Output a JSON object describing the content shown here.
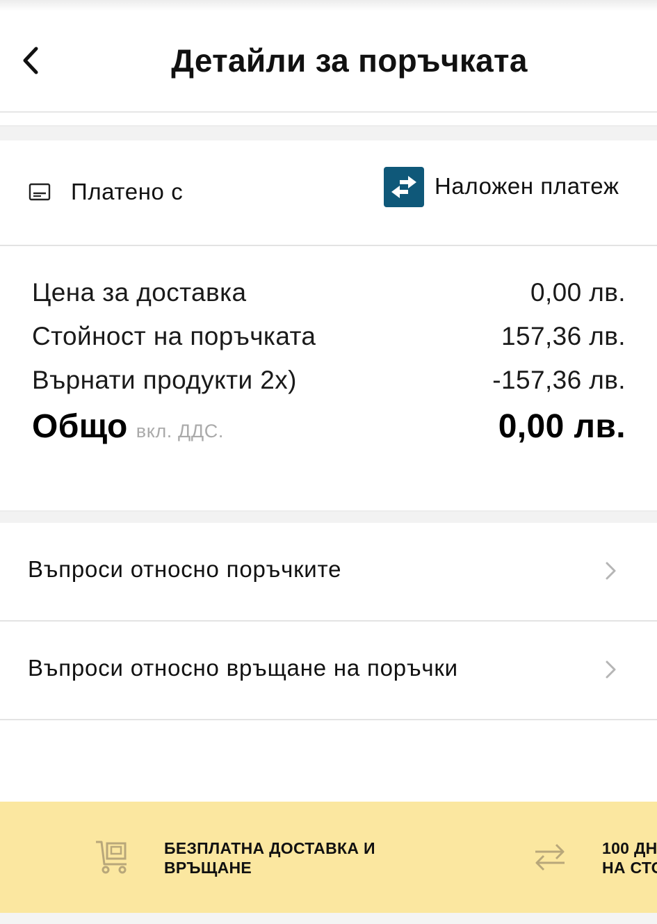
{
  "header": {
    "title": "Детайли за поръчката",
    "back_icon": "chevron-left-icon"
  },
  "payment": {
    "label": "Платено с",
    "label_icon": "card-icon",
    "method": "Наложен платеж",
    "method_icon": "swap-arrows-icon",
    "method_icon_color": "#0f5879"
  },
  "summary": {
    "rows": [
      {
        "label": "Цена за доставка",
        "value": "0,00 лв."
      },
      {
        "label": "Стойност на поръчката",
        "value": "157,36 лв."
      },
      {
        "label": "Върнати продукти 2х)",
        "value": "-157,36 лв."
      }
    ],
    "total": {
      "label": "Общо",
      "note": "вкл. ДДС.",
      "value": "0,00 лв."
    }
  },
  "links": [
    {
      "label": "Въпроси относно поръчките",
      "icon": "chevron-right-icon"
    },
    {
      "label": "Въпроси относно връщане на поръчки",
      "icon": "chevron-right-icon"
    }
  ],
  "banner": {
    "background": "#fbe7a0",
    "items": [
      {
        "icon": "cart-icon",
        "line1": "БЕЗПЛАТНА ДОСТАВКА И",
        "line2": "ВРЪЩАНЕ"
      },
      {
        "icon": "swap-arrows-icon",
        "line1": "100 ДН",
        "line2": "НА СТО"
      }
    ]
  }
}
